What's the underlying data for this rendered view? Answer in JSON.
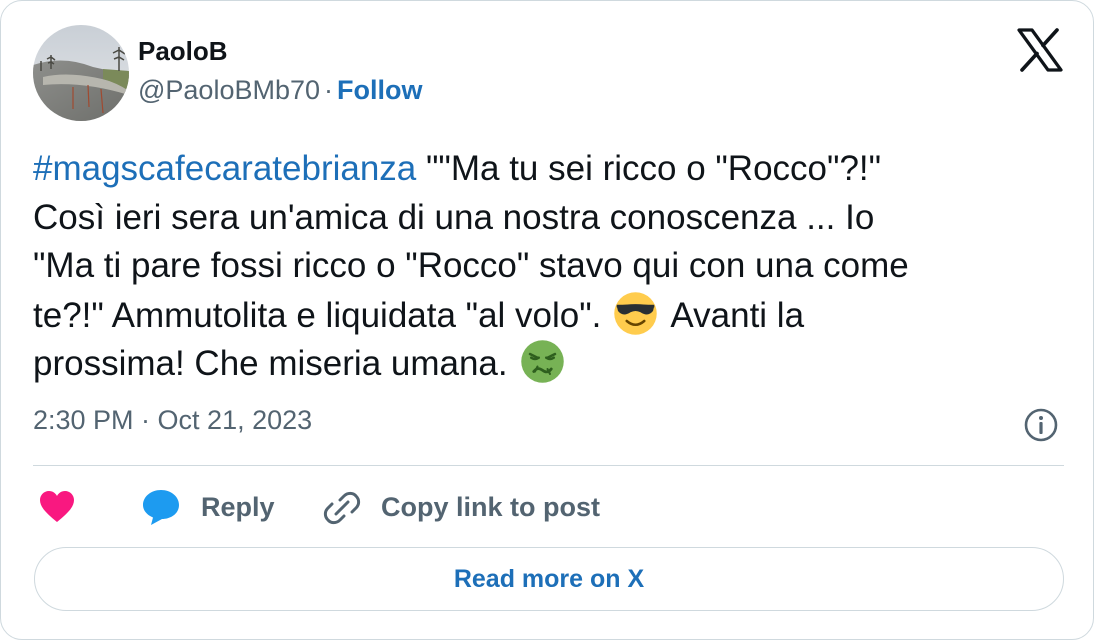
{
  "author": {
    "display_name": "PaoloB",
    "handle": "@PaoloBMb70",
    "separator": "·",
    "follow_label": "Follow"
  },
  "tweet": {
    "line1_hashtag": "#magscafecaratebrianza",
    "line1_rest": " \"\"Ma tu sei ricco o \"Rocco\"?!\"",
    "line2": "Così ieri sera un'amica di una nostra conoscenza ... Io",
    "line3": "\"Ma ti pare fossi ricco o \"Rocco\" stavo qui con una come",
    "line4_a": "te?!\" Ammutolita e liquidata \"al volo\".",
    "line4_b": "Avanti la",
    "line5": "prossima! Che miseria umana.",
    "emoji_1": "smiling-face-with-sunglasses",
    "emoji_2": "nauseated-face"
  },
  "timestamp": "2:30 PM · Oct 21, 2023",
  "actions": {
    "reply_label": "Reply",
    "copy_link_label": "Copy link to post"
  },
  "read_more_label": "Read more on X",
  "colors": {
    "link": "#1d6fb8",
    "secondary_text": "#536471",
    "primary_text": "#0f1419",
    "heart": "#f91880",
    "reply_bubble": "#1d9bf0",
    "border": "#cfd9de"
  },
  "icons": {
    "brand": "x-logo-icon",
    "info": "info-icon",
    "like": "heart-icon",
    "reply": "speech-bubble-icon",
    "copy": "link-icon"
  }
}
